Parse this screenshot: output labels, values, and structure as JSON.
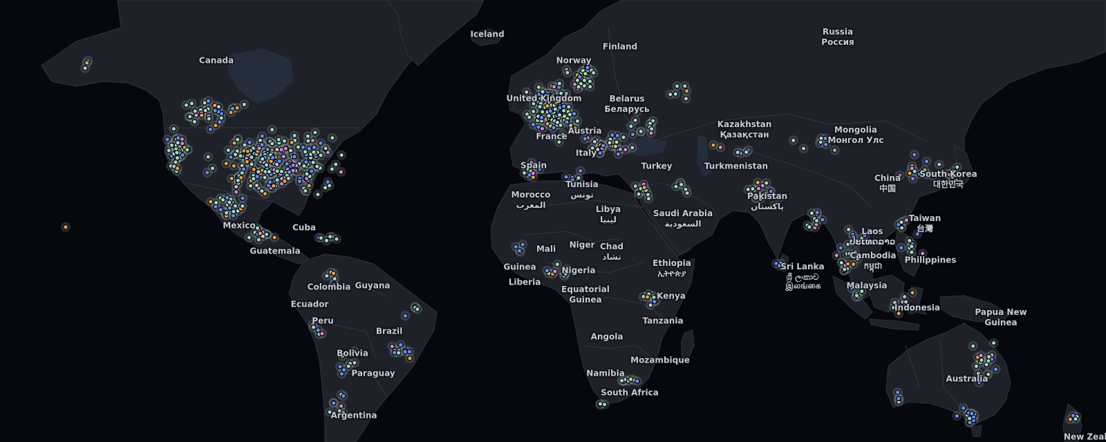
{
  "map": {
    "theme": "dark",
    "colors": {
      "ocean": "#06080e",
      "land": "#1f2129",
      "border": "#343844",
      "marker_default": "#a7d8c0",
      "marker_blue": "#6e8ff2",
      "marker_orange": "#e8a34c",
      "marker_pink": "#d68ad8"
    },
    "country_labels": [
      {
        "name": "Canada",
        "native": ""
      },
      {
        "name": "Iceland",
        "native": ""
      },
      {
        "name": "Finland",
        "native": ""
      },
      {
        "name": "Norway",
        "native": ""
      },
      {
        "name": "Russia",
        "native": "Россия"
      },
      {
        "name": "Belarus",
        "native": "Беларусь"
      },
      {
        "name": "Kazakhstan",
        "native": "Қазақстан"
      },
      {
        "name": "Mongolia",
        "native": "Монгол Улс"
      },
      {
        "name": "United Kingdom",
        "native": ""
      },
      {
        "name": "France",
        "native": ""
      },
      {
        "name": "Austria",
        "native": ""
      },
      {
        "name": "Italy",
        "native": ""
      },
      {
        "name": "Spain",
        "native": ""
      },
      {
        "name": "Turkey",
        "native": ""
      },
      {
        "name": "Turkmenistan",
        "native": ""
      },
      {
        "name": "China",
        "native": "中国"
      },
      {
        "name": "South Korea",
        "native": "대한민국"
      },
      {
        "name": "Tunisia",
        "native": "تونس"
      },
      {
        "name": "Morocco",
        "native": "المغرب"
      },
      {
        "name": "Libya",
        "native": "ليبيا"
      },
      {
        "name": "Saudi Arabia",
        "native": "السعودية"
      },
      {
        "name": "Pakistan",
        "native": "پاکستان"
      },
      {
        "name": "Taiwan",
        "native": "台灣"
      },
      {
        "name": "Laos",
        "native": "ປະເທດລາວ"
      },
      {
        "name": "Cambodia",
        "native": "កម្ពុជា"
      },
      {
        "name": "Philippines",
        "native": ""
      },
      {
        "name": "Mexico",
        "native": ""
      },
      {
        "name": "Cuba",
        "native": ""
      },
      {
        "name": "Guatemala",
        "native": ""
      },
      {
        "name": "Mali",
        "native": ""
      },
      {
        "name": "Niger",
        "native": ""
      },
      {
        "name": "Chad",
        "native": "تشاد"
      },
      {
        "name": "Ethiopia",
        "native": "ኢትዮጵያ"
      },
      {
        "name": "Sri Lanka",
        "native": "ශ්‍රී ලංකාව"
      },
      {
        "name": "",
        "native": "இலங்கை"
      },
      {
        "name": "Guinea",
        "native": ""
      },
      {
        "name": "Nigeria",
        "native": ""
      },
      {
        "name": "Liberia",
        "native": ""
      },
      {
        "name": "Malaysia",
        "native": ""
      },
      {
        "name": "Colombia",
        "native": ""
      },
      {
        "name": "Guyana",
        "native": ""
      },
      {
        "name": "Equatorial",
        "native": "Guinea"
      },
      {
        "name": "Kenya",
        "native": ""
      },
      {
        "name": "Ecuador",
        "native": ""
      },
      {
        "name": "Indonesia",
        "native": ""
      },
      {
        "name": "Papua New",
        "native": "Guinea"
      },
      {
        "name": "Peru",
        "native": ""
      },
      {
        "name": "Tanzania",
        "native": ""
      },
      {
        "name": "Brazil",
        "native": ""
      },
      {
        "name": "Angola",
        "native": ""
      },
      {
        "name": "Bolivia",
        "native": ""
      },
      {
        "name": "Mozambique",
        "native": ""
      },
      {
        "name": "Paraguay",
        "native": ""
      },
      {
        "name": "Namibia",
        "native": ""
      },
      {
        "name": "Australia",
        "native": ""
      },
      {
        "name": "South Africa",
        "native": ""
      },
      {
        "name": "Argentina",
        "native": ""
      },
      {
        "name": "New Zealand",
        "native": ""
      }
    ]
  }
}
